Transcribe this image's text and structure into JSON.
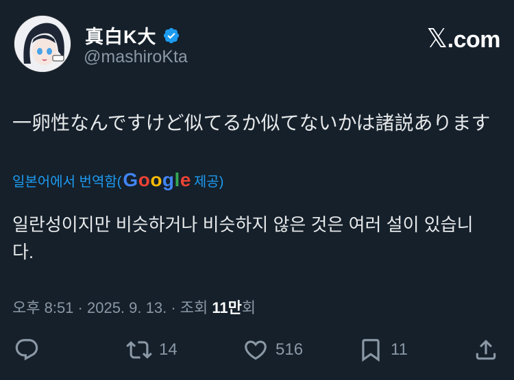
{
  "author": {
    "display_name": "真白K大",
    "handle": "@mashiroKta",
    "verified": true
  },
  "brand": {
    "x_glyph": "𝕏",
    "suffix": ".com"
  },
  "tweet": {
    "text": "一卵性なんですけど似てるか似てないかは諸説あります"
  },
  "translation": {
    "prefix": "일본어에서 번역함(",
    "google": [
      "G",
      "o",
      "o",
      "g",
      "l",
      "e"
    ],
    "suffix": " 제공)",
    "text": "일란성이지만 비슷하거나 비슷하지 않은 것은 여러 설이 있습니다."
  },
  "meta": {
    "time": "오후 8:51",
    "sep1": " · ",
    "date": "2025. 9. 13.",
    "sep2": " · ",
    "views_prefix": "조회 ",
    "views_count": "11만",
    "views_suffix": "회"
  },
  "actions": {
    "reply_icon": "reply-icon",
    "retweet_count": "14",
    "like_count": "516",
    "bookmark_count": "11",
    "share_icon": "share-icon"
  },
  "colors": {
    "background": "#15202b",
    "accent": "#1d9bf0",
    "muted": "#8b98a5"
  }
}
